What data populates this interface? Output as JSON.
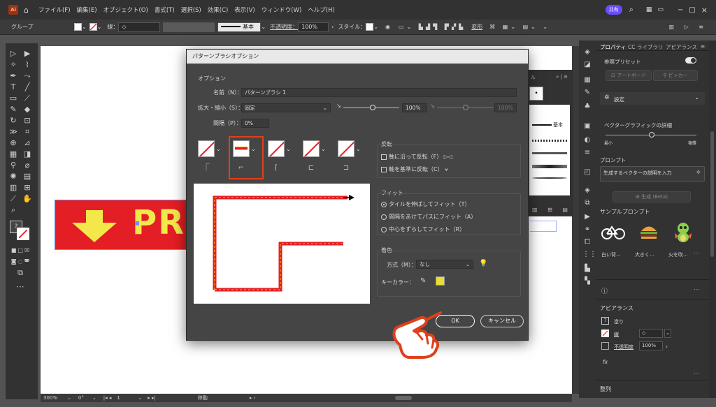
{
  "app": {
    "logo": "Ai",
    "menus": [
      "ファイル(F)",
      "編集(E)",
      "オブジェクト(O)",
      "書式(T)",
      "選択(S)",
      "効果(C)",
      "表示(V)",
      "ウィンドウ(W)",
      "ヘルプ(H)"
    ],
    "share_label": "共有",
    "window_controls": [
      "−",
      "□",
      "×"
    ]
  },
  "control_bar": {
    "group_label": "グループ",
    "stroke_label": "線：",
    "brush_label": "基本",
    "opacity_label": "不透明度：",
    "opacity_value": "100%",
    "style_label": "スタイル：",
    "transform_label": "変形"
  },
  "artwork": {
    "banner_text": "PRI",
    "banner_color": "#e31e24",
    "accent_color": "#f2e84a"
  },
  "status_bar": {
    "zoom": "300%",
    "rotation": "0°",
    "artboard": "1",
    "mode": "移動"
  },
  "bg_panel": {
    "tab_label": "ル",
    "brush_basic": "基本"
  },
  "dialog": {
    "title": "パターンブラシオプション",
    "options_label": "オプション",
    "name_label": "名前（N）：",
    "name_value": "パターンブラシ 1",
    "scale_label": "拡大・縮小（S）：",
    "scale_mode": "固定",
    "scale_value": "100%",
    "scale_value2": "100%",
    "spacing_label": "間隔（P）：",
    "spacing_value": "0%",
    "flip_label": "反転",
    "flip_along": "軸に沿って反転（F）",
    "flip_across": "軸を基準に反転（C）",
    "fit_label": "フィット",
    "fit_options": [
      "タイルを伸ばしてフィット（T）",
      "間隔をあけてパスにフィット（A）",
      "中心をずらしてフィット（R）"
    ],
    "fit_selected": 0,
    "color_label": "着色",
    "method_label": "方式（M）：",
    "method_value": "なし",
    "keycolor_label": "キーカラー：",
    "keycolor": "#e8e030",
    "ok_label": "OK",
    "cancel_label": "キャンセル"
  },
  "right_panel": {
    "tabs": [
      "プロパティ",
      "CC ライブラリ",
      "アピアランス"
    ],
    "ref_preset": "参照プリセット",
    "artboard_btn": "アートボード",
    "picker_btn": "ピッカー",
    "settings_label": "設定",
    "vector_detail": "ベクターグラフィックの詳細",
    "detail_min": "最小",
    "detail_max": "複雑",
    "prompt_label": "プロンプト",
    "prompt_placeholder": "生成するベクターの説明を入力",
    "generate_btn": "生成 (Beta)",
    "sample_label": "サンプルプロンプト",
    "samples": [
      "白い背...",
      "大きく...",
      "火を吹..."
    ],
    "appearance_label": "アピアランス",
    "fill_label": "塗り",
    "stroke_label": "線",
    "opacity_label": "不透明度",
    "opacity_value": "100%",
    "fx_label": "fx",
    "align_label": "整列"
  }
}
